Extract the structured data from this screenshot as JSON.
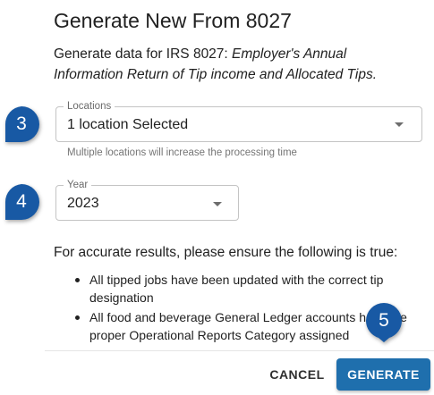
{
  "dialog": {
    "title": "Generate New From 8027",
    "description_prefix": "Generate data for IRS 8027: ",
    "description_italic": "Employer's Annual Information Return of Tip income and Allocated Tips."
  },
  "locations": {
    "label": "Locations",
    "value": "1 location Selected",
    "helper": "Multiple locations will increase the processing time"
  },
  "year": {
    "label": "Year",
    "value": "2023"
  },
  "notice": {
    "heading": "For accurate results, please ensure the following is true:",
    "items": [
      "All tipped jobs have been updated with the correct tip designation",
      "All food and beverage General Ledger accounts have the proper Operational Reports Category assigned"
    ]
  },
  "actions": {
    "cancel_label": "CANCEL",
    "generate_label": "GENERATE"
  },
  "markers": [
    "3",
    "4",
    "5"
  ],
  "colors": {
    "primary": "#1f6fad",
    "marker": "#1859a4"
  }
}
